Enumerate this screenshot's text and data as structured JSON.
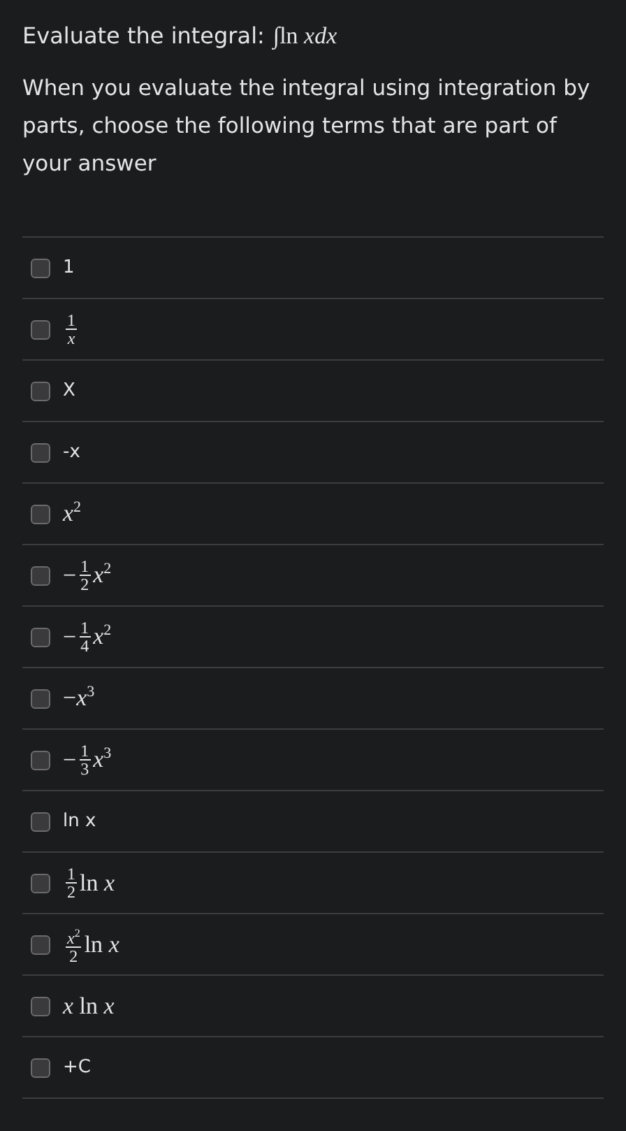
{
  "question": {
    "prompt": "Evaluate the integral:",
    "expression": "∫ln *xdx*",
    "instruction": "When you evaluate the integral using integration by parts, choose the following terms that are part of your answer"
  },
  "options": [
    {
      "checked": false,
      "kind": "plain",
      "parts": [
        {
          "kind": "text",
          "text": "1"
        }
      ]
    },
    {
      "checked": false,
      "kind": "math",
      "parts": [
        {
          "kind": "frac",
          "num": "1",
          "den": "*x*"
        }
      ]
    },
    {
      "checked": false,
      "kind": "plain",
      "parts": [
        {
          "kind": "text",
          "text": "X"
        }
      ]
    },
    {
      "checked": false,
      "kind": "plain",
      "parts": [
        {
          "kind": "text",
          "text": "-x"
        }
      ]
    },
    {
      "checked": false,
      "kind": "math",
      "parts": [
        {
          "kind": "text",
          "text": "*x*$^{2}$"
        }
      ]
    },
    {
      "checked": false,
      "kind": "math",
      "parts": [
        {
          "kind": "text",
          "text": "−"
        },
        {
          "kind": "frac",
          "num": "1",
          "den": "2"
        },
        {
          "kind": "text",
          "text": "*x*$^{2}$"
        }
      ]
    },
    {
      "checked": false,
      "kind": "math",
      "parts": [
        {
          "kind": "text",
          "text": "−"
        },
        {
          "kind": "frac",
          "num": "1",
          "den": "4"
        },
        {
          "kind": "text",
          "text": "*x*$^{2}$"
        }
      ]
    },
    {
      "checked": false,
      "kind": "math",
      "parts": [
        {
          "kind": "text",
          "text": "−*x*$^{3}$"
        }
      ]
    },
    {
      "checked": false,
      "kind": "math",
      "parts": [
        {
          "kind": "text",
          "text": "−"
        },
        {
          "kind": "frac",
          "num": "1",
          "den": "3"
        },
        {
          "kind": "text",
          "text": "*x*$^{3}$"
        }
      ]
    },
    {
      "checked": false,
      "kind": "plain",
      "parts": [
        {
          "kind": "text",
          "text": "ln x"
        }
      ]
    },
    {
      "checked": false,
      "kind": "math",
      "parts": [
        {
          "kind": "frac",
          "num": "1",
          "den": "2"
        },
        {
          "kind": "text",
          "text": "ln *x*"
        }
      ]
    },
    {
      "checked": false,
      "kind": "math",
      "parts": [
        {
          "kind": "frac",
          "num": "*x*$^{2}$",
          "den": "2"
        },
        {
          "kind": "text",
          "text": "ln *x*"
        }
      ]
    },
    {
      "checked": false,
      "kind": "math",
      "parts": [
        {
          "kind": "text",
          "text": "*x* ln *x*"
        }
      ]
    },
    {
      "checked": false,
      "kind": "plain",
      "parts": [
        {
          "kind": "text",
          "text": "+C"
        }
      ]
    }
  ]
}
